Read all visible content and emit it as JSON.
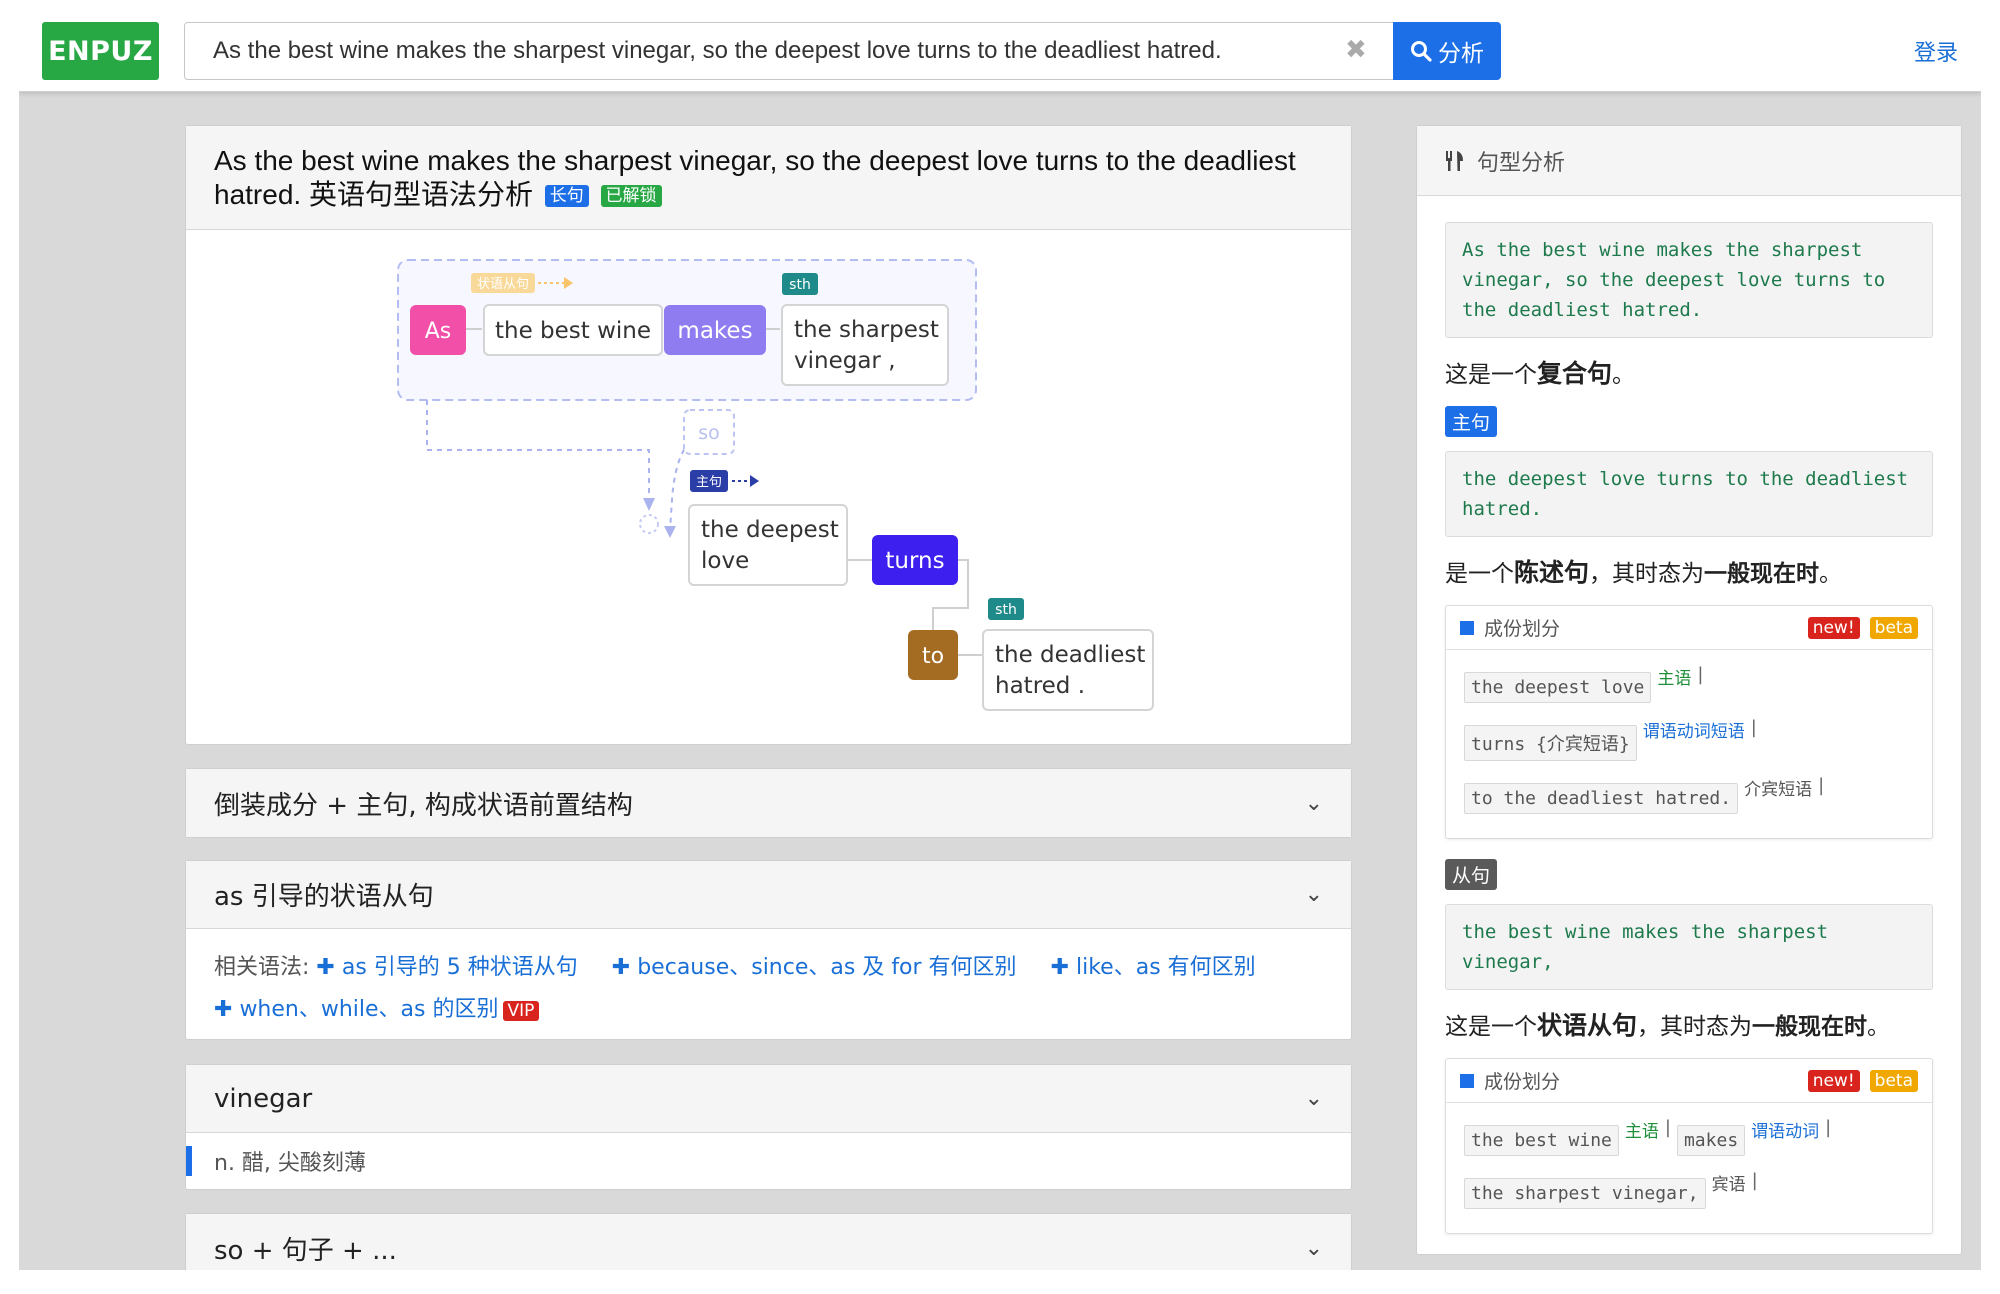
{
  "header": {
    "logo": "ENPUZ",
    "search_value": "As the best wine makes the sharpest vinegar, so the deepest love turns to the deadliest hatred.",
    "analyze_label": "分析",
    "login_label": "登录"
  },
  "main": {
    "title": "As the best wine makes the sharpest vinegar, so the deepest love turns to the deadliest hatred. 英语句型语法分析",
    "badge_long": "长句",
    "badge_unlocked": "已解锁"
  },
  "diagram": {
    "clause_label": "状语从句",
    "main_label": "主句",
    "sth1": "sth",
    "sth2": "sth",
    "as": "As",
    "best_wine": "the best wine",
    "makes": "makes",
    "sharpest_1": "the sharpest",
    "sharpest_2": "vinegar ,",
    "so": "so",
    "deepest_1": "the deepest",
    "deepest_2": "love",
    "turns": "turns",
    "to": "to",
    "deadliest_1": "the deadliest",
    "deadliest_2": "hatred ."
  },
  "sections": {
    "s1_title": "倒装成分 + 主句, 构成状语前置结构",
    "s2_title": "as 引导的状语从句",
    "related_label": "相关语法:",
    "related_1": "as 引导的 5 种状语从句",
    "related_2": "because、since、as 及 for 有何区别",
    "related_3": "like、as 有何区别",
    "related_4": "when、while、as 的区别",
    "vip": "VIP",
    "s3_title": "vinegar",
    "s3_def": "n. 醋, 尖酸刻薄",
    "s4_title": "so + 句子 + ..."
  },
  "side": {
    "title": "句型分析",
    "sentence": "As the best wine makes the sharpest vinegar, so the deepest love turns to the deadliest hatred.",
    "summary_pre": "这是一个",
    "summary_bold": "复合句",
    "summary_post": "。",
    "main_tag": "主句",
    "main_sentence": "the deepest love turns to the deadliest hatred.",
    "main_desc_pre": "是一个",
    "main_desc_bold": "陈述句",
    "main_desc_mid": "，其时态为",
    "main_desc_tense": "一般现在时",
    "main_desc_end": "。",
    "comp_title": "成份划分",
    "new_badge": "new!",
    "beta_badge": "beta",
    "c1_chip": "the deepest love",
    "c1_role": "主语",
    "c2_chip": "turns {介宾短语}",
    "c2_role": "谓语动词短语",
    "c3_chip": "to the deadliest hatred.",
    "c3_role": "介宾短语",
    "sub_tag": "从句",
    "sub_sentence": "the best wine makes the sharpest vinegar,",
    "sub_desc_pre": "这是一个",
    "sub_desc_bold": "状语从句",
    "sub_desc_mid": "，其时态为",
    "sub_desc_tense": "一般现在时",
    "sub_desc_end": "。",
    "d1_chip": "the best wine",
    "d1_role": "主语",
    "d2_chip": "makes",
    "d2_role": "谓语动词",
    "d3_chip": "the sharpest vinegar,",
    "d3_role": "宾语",
    "pipe": "|"
  }
}
